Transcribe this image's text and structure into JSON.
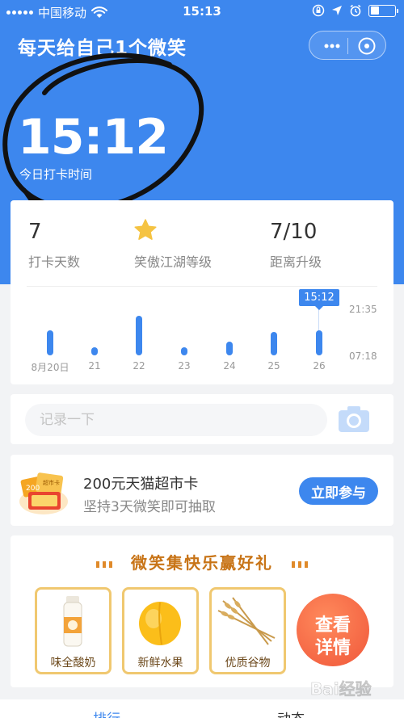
{
  "status_bar": {
    "carrier": "中国移动",
    "time": "15:13"
  },
  "header": {
    "title": "每天给自己1个微笑"
  },
  "checkin": {
    "time": "15:12",
    "label": "今日打卡时间"
  },
  "stats": [
    {
      "value": "7",
      "label": "打卡天数"
    },
    {
      "value": "",
      "label": "笑傲江湖等级"
    },
    {
      "value": "7/10",
      "label": "距离升级"
    }
  ],
  "chart_data": {
    "type": "bar",
    "categories": [
      "8月20日",
      "21",
      "22",
      "23",
      "24",
      "25",
      "26"
    ],
    "y_tick_labels": [
      "21:35",
      "07:18"
    ],
    "highlight": {
      "category": "26",
      "label": "15:12"
    },
    "values": [
      0.6,
      0.2,
      0.95,
      0.2,
      0.32,
      0.55,
      0.6
    ]
  },
  "record": {
    "placeholder": "记录一下"
  },
  "promo": {
    "title": "200元天猫超市卡",
    "subtitle": "坚持3天微笑即可抽取",
    "button": "立即参与",
    "gift_badge": "200",
    "gift_text": "超市卡"
  },
  "rewards": {
    "title": "微笑集快乐赢好礼",
    "items": [
      {
        "label": "味全酸奶"
      },
      {
        "label": "新鲜水果"
      },
      {
        "label": "优质谷物"
      }
    ],
    "detail_line1": "查看",
    "detail_line2": "详情"
  },
  "tabs": [
    {
      "label": "排行"
    },
    {
      "label": "动态"
    }
  ],
  "colors": {
    "primary": "#3d87ee",
    "gold": "#c87417",
    "orange": "#f0573a"
  },
  "watermark": "Bai经验"
}
